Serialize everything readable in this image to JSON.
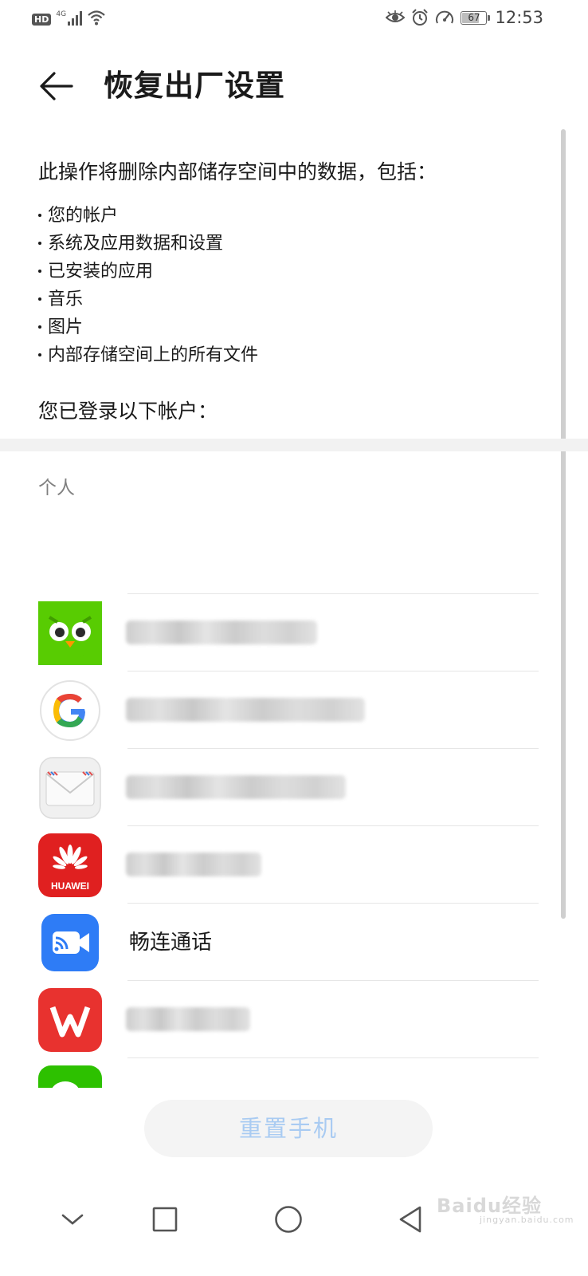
{
  "status_bar": {
    "hd_label": "HD",
    "network_type": "4G",
    "battery_level": "67",
    "time": "12:53",
    "icons": [
      "eye-icon",
      "alarm-icon",
      "speed-icon"
    ]
  },
  "app_bar": {
    "back_icon": "arrow-left-icon",
    "title": "恢复出厂设置"
  },
  "description": {
    "intro": "此操作将删除内部储存空间中的数据，包括：",
    "items": [
      "您的帐户",
      "系统及应用数据和设置",
      "已安装的应用",
      "音乐",
      "图片",
      "内部存储空间上的所有文件"
    ],
    "accounts_label": "您已登录以下帐户："
  },
  "accounts": {
    "section_title": "个人",
    "items": [
      {
        "app": "duolingo",
        "icon": "duolingo-owl-icon",
        "label": "",
        "redacted": true
      },
      {
        "app": "google",
        "icon": "google-g-icon",
        "label": "",
        "redacted": true
      },
      {
        "app": "email",
        "icon": "envelope-icon",
        "label": "",
        "redacted": true
      },
      {
        "app": "huawei",
        "icon": "huawei-logo-icon",
        "logo_text": "HUAWEI",
        "label": "",
        "redacted": true
      },
      {
        "app": "changlian",
        "icon": "video-call-icon",
        "label": "畅连通话",
        "redacted": false
      },
      {
        "app": "wps",
        "icon": "wps-logo-icon",
        "label": "",
        "redacted": true
      },
      {
        "app": "wechat",
        "icon": "wechat-icon",
        "label": "",
        "redacted": true
      }
    ]
  },
  "reset_button": {
    "label": "重置手机"
  },
  "nav_bar": {
    "icons": [
      "chevron-down-icon",
      "square-recents-icon",
      "circle-home-icon",
      "triangle-back-icon"
    ]
  },
  "watermark": {
    "text": "Baidu经验",
    "subtext": "jingyan.baidu.com"
  },
  "colors": {
    "accent": "#a9cbf2",
    "divider": "#f2f2f2",
    "duolingo": "#58cc02",
    "huawei": "#e02020",
    "wps": "#e8322f",
    "changlian": "#2e7cf6",
    "wechat": "#2dc100"
  }
}
